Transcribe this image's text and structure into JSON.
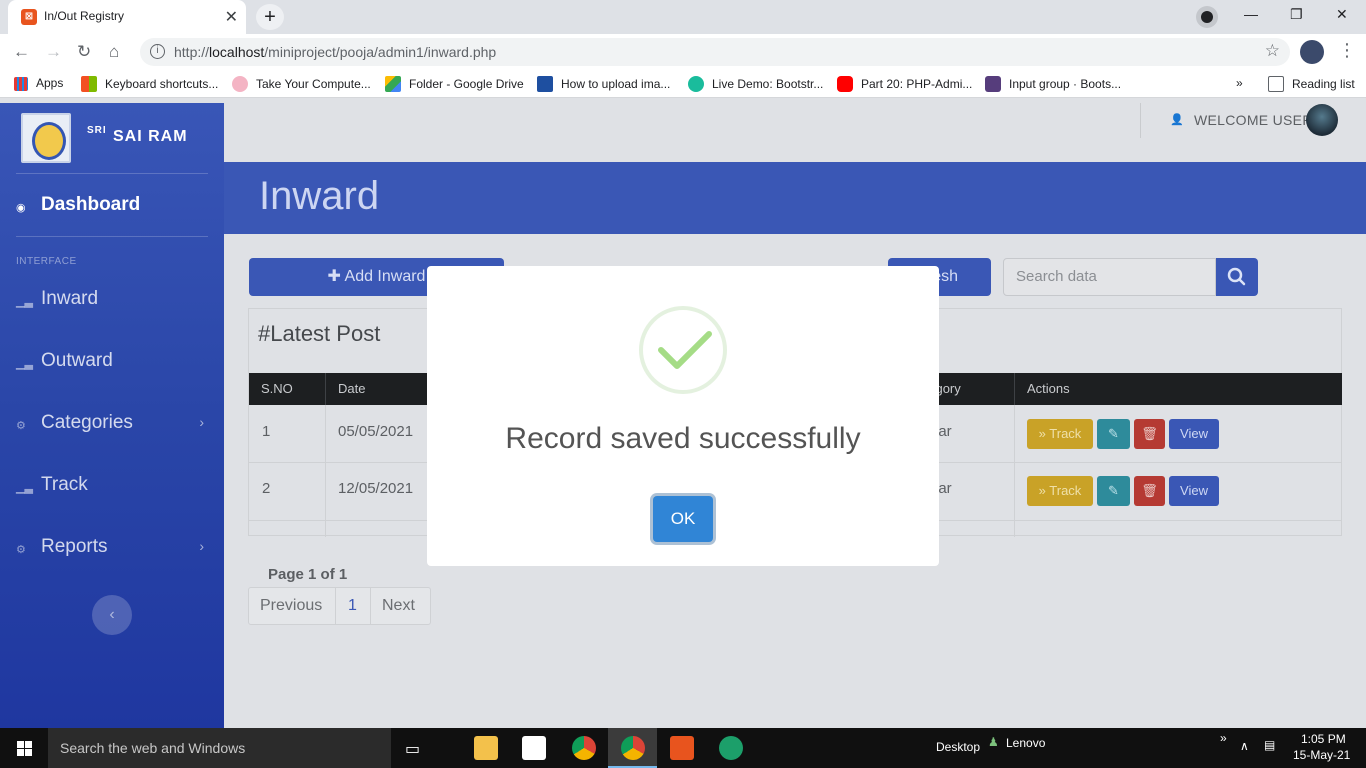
{
  "browser": {
    "tab_title": "In/Out Registry",
    "url_prefix": "http://",
    "url_host": "localhost",
    "url_path": "/miniproject/pooja/admin1/inward.php",
    "bookmarks": [
      "Apps",
      "Keyboard shortcuts...",
      "Take Your Compute...",
      "Folder - Google Drive",
      "How to upload ima...",
      "Live Demo: Bootstr...",
      "Part 20: PHP-Admi...",
      "Input group · Boots..."
    ],
    "reading_list": "Reading list"
  },
  "sidebar": {
    "brand_prefix": "SRI",
    "brand_name": "SAI RAM",
    "dashboard": "Dashboard",
    "heading": "INTERFACE",
    "items": [
      "Inward",
      "Outward",
      "Categories",
      "Track",
      "Reports"
    ]
  },
  "topbar": {
    "welcome": "WELCOME USER"
  },
  "page": {
    "title": "Inward",
    "add_button": "Add Inward",
    "refresh_button": "Refresh",
    "search_placeholder": "Search data",
    "card_title": "#Latest Post",
    "columns": [
      "S.NO",
      "Date",
      "Category",
      "Actions"
    ],
    "rows": [
      {
        "sno": "1",
        "date": "05/05/2021",
        "category": "Circular"
      },
      {
        "sno": "2",
        "date": "12/05/2021",
        "category": "Circular"
      }
    ],
    "actions": {
      "track": "Track",
      "view": "View"
    },
    "page_label": "Page 1 of 1",
    "pager": {
      "previous": "Previous",
      "current": "1",
      "next": "Next"
    }
  },
  "modal": {
    "title": "Record saved successfully",
    "ok": "OK"
  },
  "taskbar": {
    "search": "Search the web and Windows",
    "desktop": "Desktop",
    "user": "Lenovo",
    "time": "1:05 PM",
    "date": "15-May-21"
  },
  "colors": {
    "sidebar": "#2a46a8",
    "primary": "#3a57b5",
    "track": "#c9a227",
    "edit": "#2e8b9b",
    "delete": "#b53a33",
    "modal_ok": "#3085d6",
    "success": "#a5dc86"
  }
}
